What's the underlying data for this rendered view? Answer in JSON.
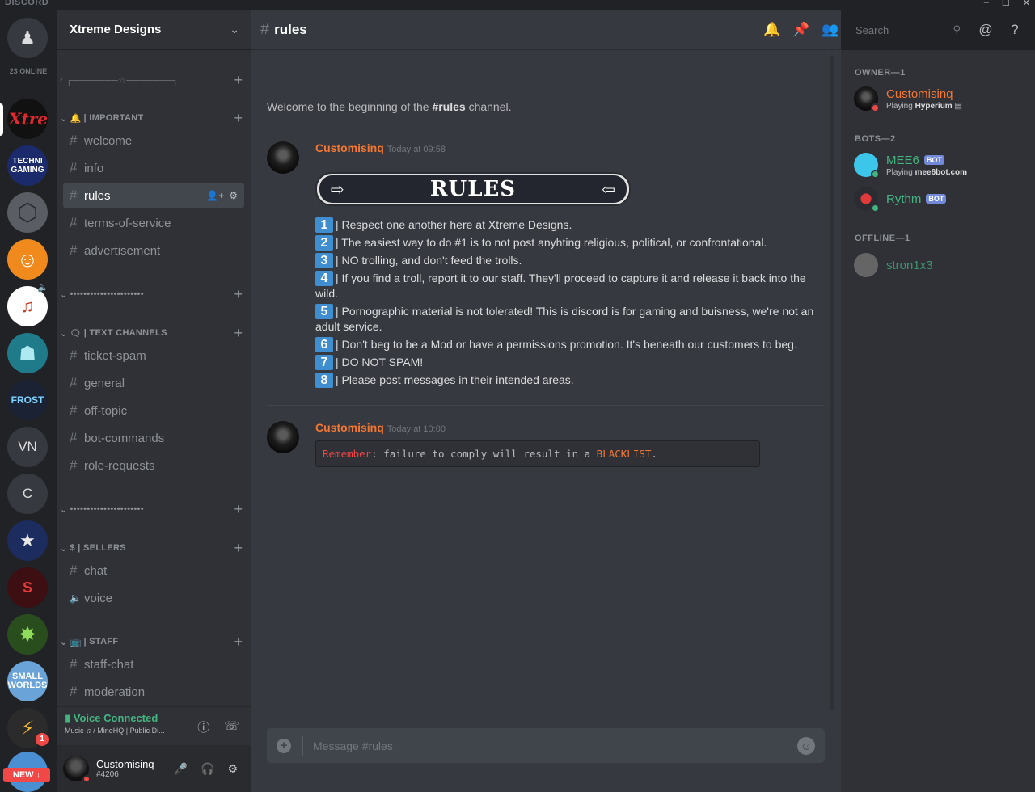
{
  "window": {
    "brand": "DISCORD",
    "controls": [
      "–",
      "☐",
      "✕"
    ]
  },
  "servers": {
    "online_count": "23 ONLINE",
    "items": [
      {
        "label": "Xtreme Designs",
        "icon": "xtreme-logo",
        "initials": "X"
      },
      {
        "label": "Techni Gaming",
        "icon": "techni-gaming-logo",
        "initials": "TG"
      },
      {
        "label": "Cube server",
        "icon": "cube-logo",
        "initials": "⬡"
      },
      {
        "label": "Avatar server",
        "icon": "glasses-avatar-logo",
        "initials": "☺"
      },
      {
        "label": "Music server",
        "icon": "music-logo",
        "initials": "♪"
      },
      {
        "label": "Robot server",
        "icon": "robot-logo",
        "initials": "☗"
      },
      {
        "label": "Frost",
        "icon": "frost-logo",
        "initials": "FROST"
      },
      {
        "label": "VN",
        "icon": "",
        "initials": "VN"
      },
      {
        "label": "C",
        "icon": "",
        "initials": "C"
      },
      {
        "label": "NSA",
        "icon": "nsa-logo",
        "initials": "★"
      },
      {
        "label": "Supreme Gaming",
        "icon": "supreme-logo",
        "initials": "S"
      },
      {
        "label": "Gaming emblem",
        "icon": "green-emblem-logo",
        "initials": "✸"
      },
      {
        "label": "Small Worlds",
        "icon": "small-worlds-logo",
        "initials": "SW"
      },
      {
        "label": "Origin",
        "icon": "origin-logo",
        "initials": "⚡"
      }
    ],
    "notification_badge": "1",
    "new_button": "NEW ↓"
  },
  "guild": {
    "name": "Xtreme Designs",
    "categories": [
      {
        "label": "‹ ┌───────☆───────┐",
        "channels": []
      },
      {
        "label": "| IMPORTANT",
        "icon": "bell-icon",
        "channels": [
          "welcome",
          "info",
          "rules",
          "terms-of-service",
          "advertisement"
        ]
      },
      {
        "label": "••••••••••••••••••••••",
        "channels": []
      },
      {
        "label": "| TEXT CHANNELS",
        "icon": "speech-bubble-icon",
        "channels": [
          "ticket-spam",
          "general",
          "off-topic",
          "bot-commands",
          "role-requests"
        ]
      },
      {
        "label": "••••••••••••••••••••••",
        "channels": []
      },
      {
        "label": "$ | SELLERS",
        "channels": [
          "chat",
          "voice"
        ]
      },
      {
        "label": "| STAFF",
        "icon": "tv-icon",
        "channels": [
          "staff-chat",
          "moderation"
        ]
      }
    ],
    "active_channel": "rules"
  },
  "voice": {
    "title": "Voice Connected",
    "subtitle": "Music ♫ / MineHQ | Public Di..."
  },
  "user": {
    "name": "Customisinq",
    "tag": "#4206",
    "status_color": "#f04747"
  },
  "chat": {
    "channel": "rules",
    "welcome_prefix": "Welcome to the beginning of the ",
    "welcome_channel": "#rules",
    "welcome_suffix": " channel.",
    "messages": [
      {
        "author": "Customisinq",
        "time": "Today at 09:58",
        "banner": "RULES",
        "rules": [
          {
            "n": "1",
            "text": "| Respect one another here at Xtreme Designs."
          },
          {
            "n": "2",
            "text": "|  The easiest way to do #1 is to not post anyhting religious, political, or confrontational."
          },
          {
            "n": "3",
            "text": "| NO trolling, and don't feed the trolls."
          },
          {
            "n": "4",
            "text": "| If you find a troll, report it to our staff. They'll proceed to capture it and release it back into the wild."
          },
          {
            "n": "5",
            "text": "| Pornographic material is not tolerated! This is discord is for gaming and buisness, we're not an adult service."
          },
          {
            "n": "6",
            "text": "| Don't beg to be a Mod or have a permissions promotion. It's beneath our customers to beg."
          },
          {
            "n": "7",
            "text": "| DO NOT SPAM!"
          },
          {
            "n": "8",
            "text": "| Please post messages in their intended areas."
          }
        ]
      },
      {
        "author": "Customisinq",
        "time": "Today at 10:00",
        "code_parts": [
          "Remember",
          ": failure to comply will result in a ",
          "BLACKLIST",
          "."
        ]
      }
    ],
    "input_placeholder": "Message #rules"
  },
  "header_tools": {
    "search_placeholder": "Search"
  },
  "members": {
    "groups": [
      {
        "label": "OWNER—1",
        "members": [
          {
            "name": "Customisinq",
            "activity_prefix": "Playing ",
            "activity": "Hyperium",
            "color": "#f57731",
            "status": "#f04747"
          }
        ]
      },
      {
        "label": "BOTS—2",
        "members": [
          {
            "name": "MEE6",
            "bot": "BOT",
            "activity_prefix": "Playing ",
            "activity": "mee6bot.com",
            "color": "#43b581",
            "status": "#43b581"
          },
          {
            "name": "Rythm",
            "bot": "BOT",
            "activity_prefix": "",
            "activity": "",
            "color": "#43b581",
            "status": "#43b581"
          }
        ]
      },
      {
        "label": "OFFLINE—1",
        "members": [
          {
            "name": "stron1x3",
            "activity_prefix": "",
            "activity": "",
            "color": "#43b581",
            "status": ""
          }
        ]
      }
    ]
  }
}
